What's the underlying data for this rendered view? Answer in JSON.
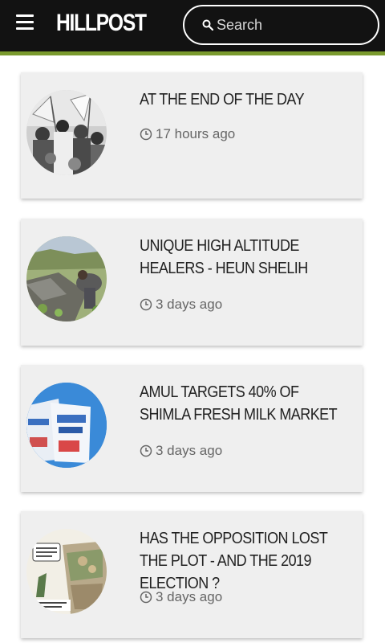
{
  "header": {
    "brand": "HILLPOST",
    "search_placeholder": "Search"
  },
  "articles": [
    {
      "title": "AT THE END OF THE DAY",
      "time": "17 hours ago",
      "thumb": "protest-crowd-photo"
    },
    {
      "title": "UNIQUE HIGH ALTITUDE HEALERS - HEUN SHELIH",
      "time": "3 days ago",
      "thumb": "herb-gatherer-photo"
    },
    {
      "title": "AMUL TARGETS 40% OF SHIMLA FRESH MILK MARKET",
      "time": "3 days ago",
      "thumb": "milk-packets-photo"
    },
    {
      "title": "HAS THE OPPOSITION LOST THE PLOT - AND THE 2019 ELECTION ?",
      "time": "3 days ago",
      "thumb": "cartoon-illustration"
    }
  ],
  "colors": {
    "topbar": "#121212",
    "accent": "#7a9a2e",
    "card": "#efefef"
  }
}
